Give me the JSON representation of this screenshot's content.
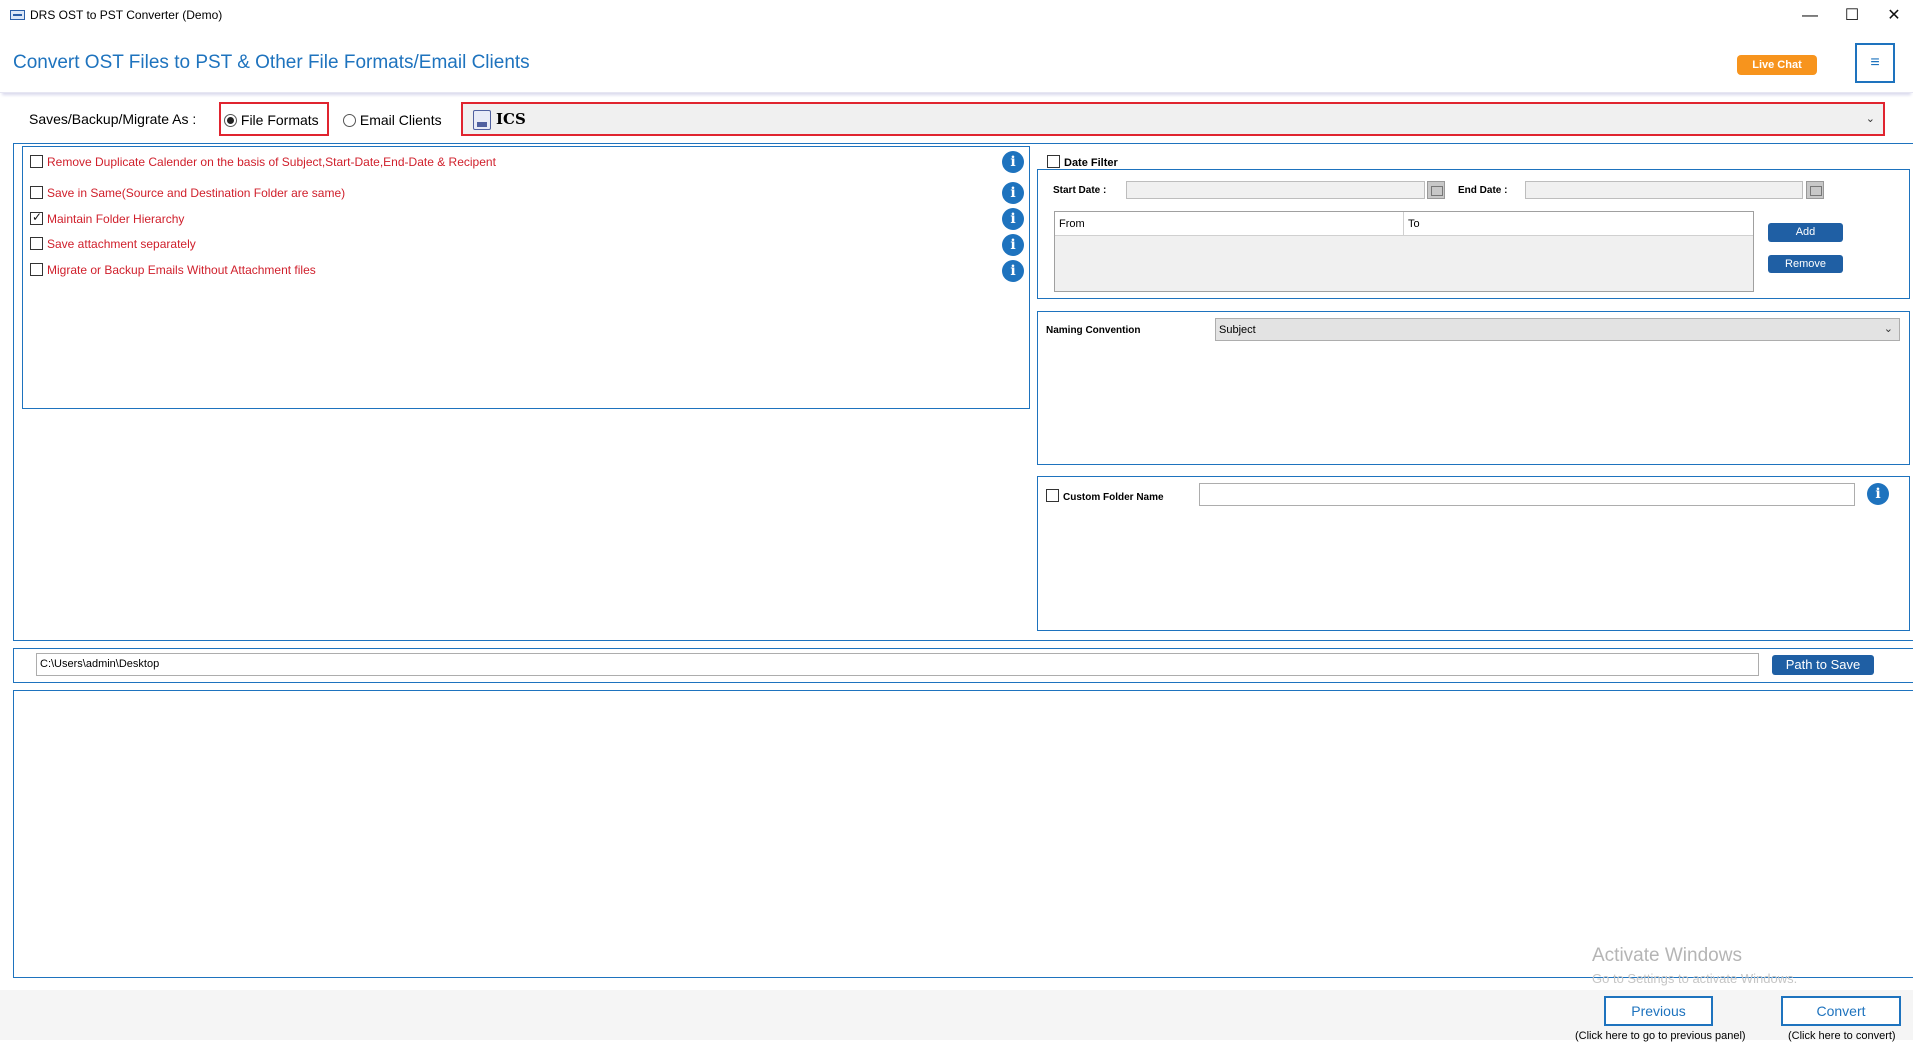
{
  "window": {
    "title": "DRS OST to PST Converter (Demo)",
    "controls": {
      "minimize": "—",
      "maximize": "☐",
      "close": "✕"
    }
  },
  "header": {
    "title": "Convert OST Files to PST & Other File Formats/Email Clients",
    "live_chat": "Live Chat",
    "menu_icon": "≡"
  },
  "save_as": {
    "label": "Saves/Backup/Migrate As :",
    "options": [
      {
        "label": "File Formats",
        "selected": true
      },
      {
        "label": "Email Clients",
        "selected": false
      }
    ],
    "format_value": "ICS"
  },
  "options": [
    {
      "label": "Remove Duplicate Calender on the basis of Subject,Start-Date,End-Date & Recipent",
      "checked": false
    },
    {
      "label": "Save in Same(Source and Destination Folder are same)",
      "checked": false
    },
    {
      "label": "Maintain Folder Hierarchy",
      "checked": true
    },
    {
      "label": "Save attachment separately",
      "checked": false
    },
    {
      "label": "Migrate or Backup Emails Without Attachment files",
      "checked": false
    }
  ],
  "info_icon": "i",
  "date_filter": {
    "label": "Date Filter",
    "start_label": "Start Date :",
    "end_label": "End Date :",
    "columns": [
      "From",
      "To"
    ],
    "add_label": "Add",
    "remove_label": "Remove"
  },
  "naming": {
    "label": "Naming Convention",
    "value": "Subject"
  },
  "custom_folder": {
    "label": "Custom Folder Name",
    "value": ""
  },
  "path": {
    "value": "C:\\Users\\admin\\Desktop",
    "button": "Path to Save"
  },
  "watermark": {
    "line1": "Activate Windows",
    "line2": "Go to Settings to activate Windows."
  },
  "footer": {
    "previous": "Previous",
    "previous_hint": "(Click here to go to previous panel)",
    "convert": "Convert",
    "convert_hint": "(Click here to convert)"
  },
  "colors": {
    "accent": "#1e73be",
    "option_text": "#d0202c",
    "live_chat": "#f7941d",
    "highlight": "#e0242f"
  }
}
